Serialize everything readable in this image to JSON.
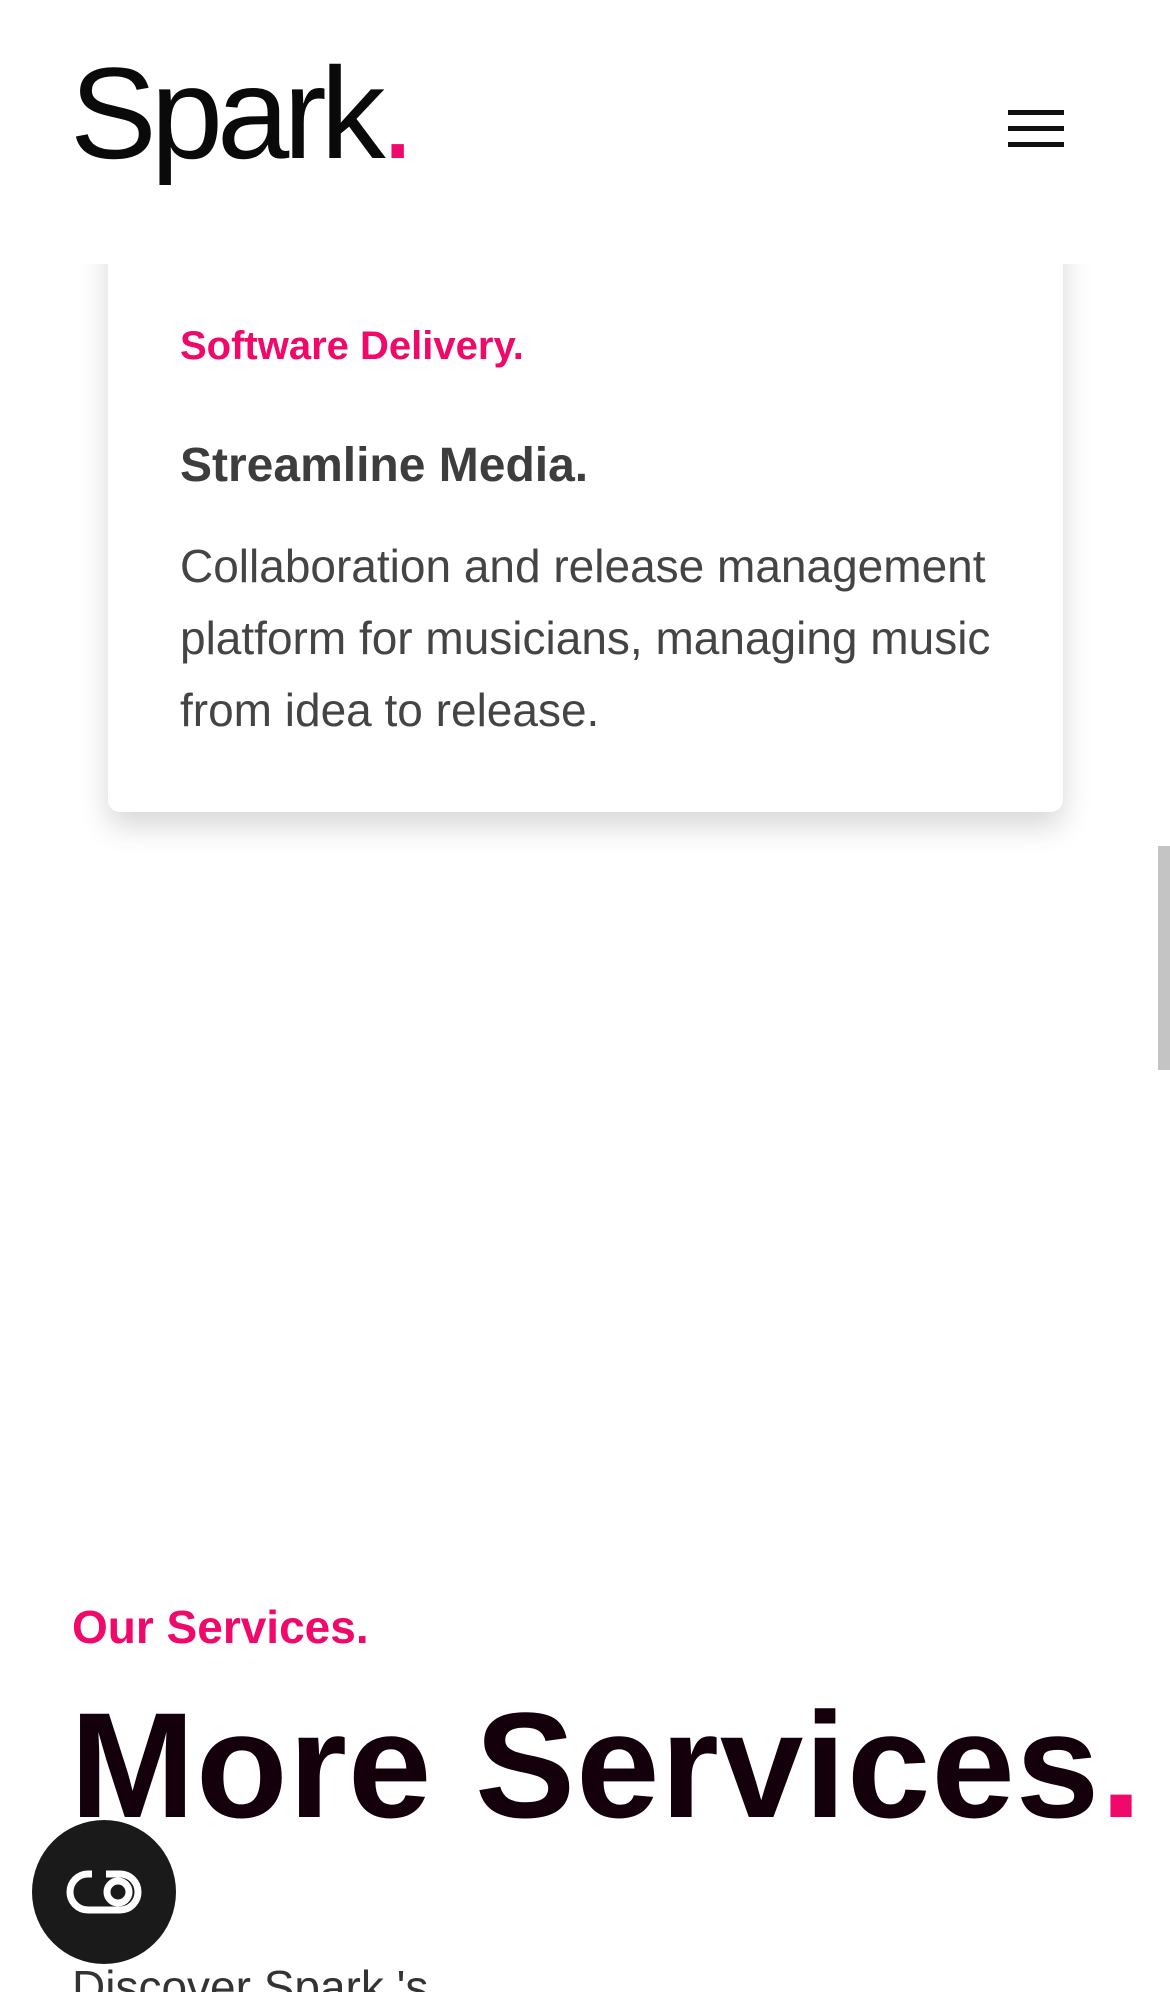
{
  "header": {
    "logo_text": "Spark",
    "logo_dot": "."
  },
  "card": {
    "eyebrow": "Software Delivery.",
    "title": "Streamline Media.",
    "body": "Collaboration and release management platform for musicians, managing music from idea to release."
  },
  "services": {
    "eyebrow": "Our Services.",
    "title": "More Services",
    "title_dot": ".",
    "body": "Discover Spark 's"
  },
  "colors": {
    "accent": "#f0086a",
    "title": "#14000a",
    "body_text": "#444444"
  },
  "icons": {
    "menu": "hamburger-menu-icon",
    "fab": "accessibility-toggle-icon"
  }
}
